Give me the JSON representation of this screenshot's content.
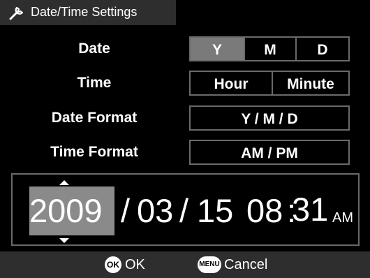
{
  "title": "Date/Time Settings",
  "rows": {
    "date": {
      "label": "Date",
      "options": [
        "Y",
        "M",
        "D"
      ],
      "selected": "Y"
    },
    "time": {
      "label": "Time",
      "options": [
        "Hour",
        "Minute"
      ]
    },
    "date_format": {
      "label": "Date Format",
      "value": "Y / M / D"
    },
    "time_format": {
      "label": "Time Format",
      "value": "AM / PM"
    }
  },
  "datetime": {
    "year": "2009",
    "sep1": "/",
    "month": "03",
    "sep2": "/",
    "day": "15",
    "hour": "08",
    "colon": ":",
    "minute": "31",
    "ampm": "AM"
  },
  "footer": {
    "ok_icon": "OK",
    "ok_label": "OK",
    "menu_icon": "MENU",
    "cancel_label": "Cancel"
  },
  "colors": {
    "background": "#000000",
    "bar": "#2e2e2e",
    "selected": "#7a7a7a",
    "border": "#6a6a6a"
  }
}
